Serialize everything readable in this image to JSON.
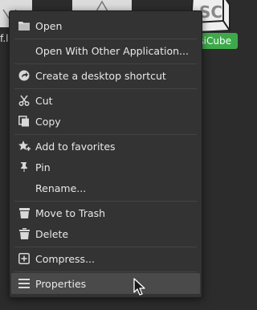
{
  "desktop": {
    "left_file_label": "f.lo",
    "app_label": "siCube"
  },
  "menu": {
    "items": [
      {
        "label": "Open",
        "icon": "folder-icon"
      },
      {
        "label": "Open With Other Application..."
      },
      {
        "label": "Create a desktop shortcut",
        "icon": "shortcut-arrow-icon"
      },
      {
        "label": "Cut",
        "icon": "scissors-icon"
      },
      {
        "label": "Copy",
        "icon": "copy-icon"
      },
      {
        "label": "Add to favorites",
        "icon": "star-plus-icon"
      },
      {
        "label": "Pin",
        "icon": "pin-icon"
      },
      {
        "label": "Rename..."
      },
      {
        "label": "Move to Trash",
        "icon": "trash-icon"
      },
      {
        "label": "Delete",
        "icon": "delete-icon"
      },
      {
        "label": "Compress...",
        "icon": "compress-icon"
      },
      {
        "label": "Properties",
        "icon": "properties-icon"
      }
    ]
  },
  "colors": {
    "menu_bg": "#333333",
    "hover_bg": "#4a4a4a",
    "text": "#e8e8e8",
    "accent_green": "#3daa4a"
  }
}
